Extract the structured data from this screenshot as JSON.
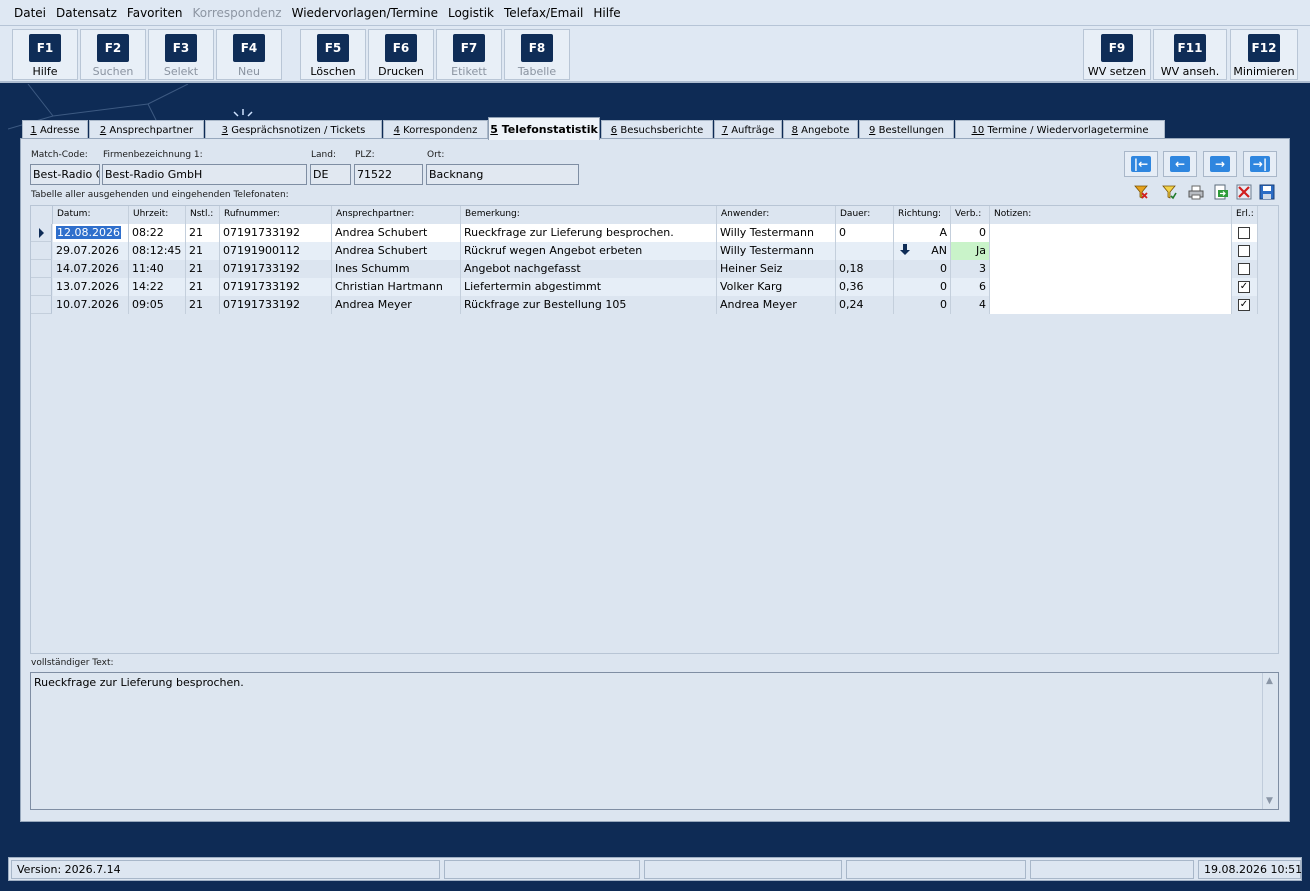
{
  "menu": [
    {
      "label": "Datei",
      "disabled": false
    },
    {
      "label": "Datensatz",
      "disabled": false
    },
    {
      "label": "Favoriten",
      "disabled": false
    },
    {
      "label": "Korrespondenz",
      "disabled": true
    },
    {
      "label": "Wiedervorlagen/Termine",
      "disabled": false
    },
    {
      "label": "Logistik",
      "disabled": false
    },
    {
      "label": "Telefax/Email",
      "disabled": false
    },
    {
      "label": "Hilfe",
      "disabled": false
    }
  ],
  "toolbar": {
    "f1": {
      "key": "F1",
      "label": "Hilfe"
    },
    "f2": {
      "key": "F2",
      "label": "Suchen"
    },
    "f3": {
      "key": "F3",
      "label": "Selekt"
    },
    "f4": {
      "key": "F4",
      "label": "Neu"
    },
    "f5": {
      "key": "F5",
      "label": "Löschen"
    },
    "f6": {
      "key": "F6",
      "label": "Drucken"
    },
    "f7": {
      "key": "F7",
      "label": "Etikett"
    },
    "f8": {
      "key": "F8",
      "label": "Tabelle"
    },
    "f9": {
      "key": "F9",
      "label": "WV setzen"
    },
    "f11": {
      "key": "F11",
      "label": "WV anseh."
    },
    "f12": {
      "key": "F12",
      "label": "Minimieren"
    }
  },
  "tabs": [
    {
      "num": "1",
      "label": "Adresse"
    },
    {
      "num": "2",
      "label": "Ansprechpartner"
    },
    {
      "num": "3",
      "label": "Gesprächsnotizen / Tickets"
    },
    {
      "num": "4",
      "label": "Korrespondenz"
    },
    {
      "num": "5",
      "label": "Telefonstatistik"
    },
    {
      "num": "6",
      "label": "Besuchsberichte"
    },
    {
      "num": "7",
      "label": "Aufträge"
    },
    {
      "num": "8",
      "label": "Angebote"
    },
    {
      "num": "9",
      "label": "Bestellungen"
    },
    {
      "num": "10",
      "label": "Termine / Wiedervorlagetermine"
    }
  ],
  "header": {
    "matchcode_label": "Match-Code:",
    "matchcode": "Best-Radio Gr",
    "firma_label": "Firmenbezeichnung 1:",
    "firma": "Best-Radio GmbH",
    "land_label": "Land:",
    "land": "DE",
    "plz_label": "PLZ:",
    "plz": "71522",
    "ort_label": "Ort:",
    "ort": "Backnang",
    "table_caption": "Tabelle aller ausgehenden und eingehenden Telefonaten:"
  },
  "table": {
    "columns": [
      "Datum:",
      "Uhrzeit:",
      "Nstl.:",
      "Rufnummer:",
      "Ansprechpartner:",
      "Bemerkung:",
      "Anwender:",
      "Dauer:",
      "Richtung:",
      "Verb.:",
      "Notizen:",
      "Erl.:"
    ],
    "rows": [
      {
        "datum": "12.08.2026",
        "uhrzeit": "08:22",
        "nstl": "21",
        "ruf": "07191733192",
        "ap": "Andrea Schubert",
        "bem": "Rueckfrage zur Lieferung besprochen.",
        "anw": "Willy Testermann",
        "dauer": "0",
        "richtung": "A",
        "verb": "0",
        "notiz": "",
        "erl": false
      },
      {
        "datum": "29.07.2026",
        "uhrzeit": "08:12:45",
        "nstl": "21",
        "ruf": "07191900112",
        "ap": "Andrea Schubert",
        "bem": "Rückruf wegen Angebot erbeten",
        "anw": "Willy Testermann",
        "dauer": "",
        "richtung": "AN",
        "verb": "Ja",
        "notiz": "",
        "erl": false
      },
      {
        "datum": "14.07.2026",
        "uhrzeit": "11:40",
        "nstl": "21",
        "ruf": "07191733192",
        "ap": "Ines Schumm",
        "bem": "Angebot nachgefasst",
        "anw": "Heiner Seiz",
        "dauer": "0,18",
        "richtung": "0",
        "verb": "3",
        "notiz": "",
        "erl": false
      },
      {
        "datum": "13.07.2026",
        "uhrzeit": "14:22",
        "nstl": "21",
        "ruf": "07191733192",
        "ap": "Christian Hartmann",
        "bem": "Liefertermin abgestimmt",
        "anw": "Volker Karg",
        "dauer": "0,36",
        "richtung": "0",
        "verb": "6",
        "notiz": "",
        "erl": true
      },
      {
        "datum": "10.07.2026",
        "uhrzeit": "09:05",
        "nstl": "21",
        "ruf": "07191733192",
        "ap": "Andrea Meyer",
        "bem": "Rückfrage zur Bestellung 105",
        "anw": "Andrea Meyer",
        "dauer": "0,24",
        "richtung": "0",
        "verb": "4",
        "notiz": "",
        "erl": true
      }
    ]
  },
  "fulltext": {
    "label": "vollständiger Text:",
    "value": "Rueckfrage zur Lieferung besprochen."
  },
  "status": {
    "version": "Version: 2026.7.14",
    "datetime": "19.08.2026 10:51"
  },
  "colors": {
    "background": "#0e2b55",
    "accent": "#2f86df",
    "selection": "#2f6fcc",
    "verb_yes": "#c9f3c9"
  }
}
